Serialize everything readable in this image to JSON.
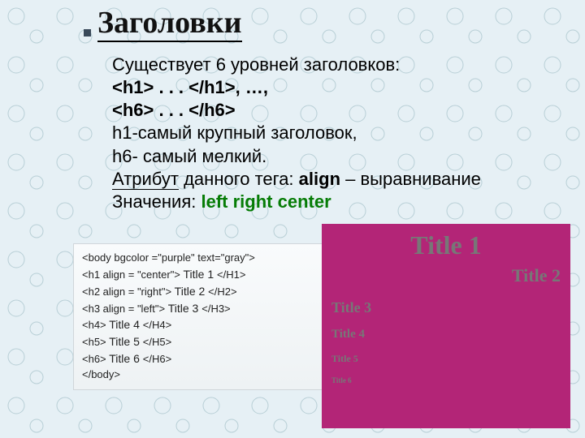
{
  "title": "Заголовки",
  "intro": {
    "line1": "Существует 6 уровней заголовков:",
    "h1tag": "<h1> . . . </h1>, …,",
    "h6tag": "<h6> . . . </h6>",
    "largest": "h1-самый крупный заголовок,",
    "smallest": "h6- самый мелкий.",
    "attr_prefix": "Атрибут",
    "attr_rest": " данного тега: ",
    "attr_name": "align",
    "attr_desc": " – выравнивание",
    "values_label": "Значения: ",
    "val_left": "left",
    "val_right": "right",
    "val_center": "center"
  },
  "code": {
    "l0": "<body  bgcolor =\"purple\" text=\"gray\">",
    "l1a": "<h1 align = \"center\"> ",
    "l1b": "Title 1 ",
    "l1c": "</H1>",
    "l2a": "<h2 align = \"right\"> ",
    "l2b": "Title 2 ",
    "l2c": "</H2>",
    "l3a": "<h3 align = \"left\"> ",
    "l3b": "Title 3 ",
    "l3c": "</H3>",
    "l4a": "<h4> ",
    "l4b": "Title 4 ",
    "l4c": "</H4>",
    "l5a": "<h5> ",
    "l5b": "Title 5 ",
    "l5c": "</H5>",
    "l6a": "<h6> ",
    "l6b": "Title 6 ",
    "l6c": "</H6>",
    "l7": "</body>"
  },
  "preview": {
    "t1": "Title 1",
    "t2": "Title 2",
    "t3": "Title 3",
    "t4": "Title 4",
    "t5": "Title 5",
    "t6": "Title 6"
  }
}
